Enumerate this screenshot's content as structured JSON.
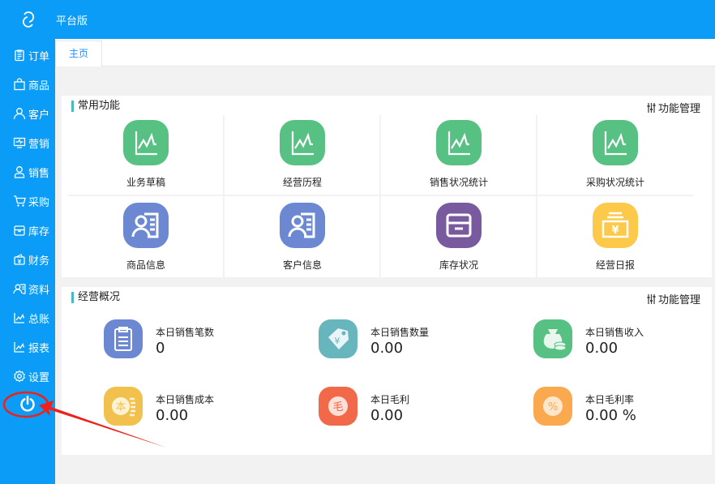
{
  "header": {
    "brand": "平台版",
    "logo_icon": "cloud-logo-icon"
  },
  "sidebar": {
    "items": [
      {
        "label": "订单",
        "icon": "clipboard-icon"
      },
      {
        "label": "商品",
        "icon": "bag-icon"
      },
      {
        "label": "客户",
        "icon": "user-icon"
      },
      {
        "label": "营销",
        "icon": "monitor-icon"
      },
      {
        "label": "销售",
        "icon": "person-icon"
      },
      {
        "label": "采购",
        "icon": "cart-icon"
      },
      {
        "label": "库存",
        "icon": "box-icon"
      },
      {
        "label": "财务",
        "icon": "wallet-icon"
      },
      {
        "label": "资料",
        "icon": "contact-icon"
      },
      {
        "label": "总账",
        "icon": "chart-icon"
      },
      {
        "label": "报表",
        "icon": "chart-icon"
      },
      {
        "label": "设置",
        "icon": "gear-icon"
      }
    ],
    "power_icon": "power-icon"
  },
  "tabs": [
    {
      "label": "主页"
    }
  ],
  "common": {
    "title": "常用功能",
    "manage": "功能管理",
    "items": [
      {
        "label": "业务草稿",
        "color": "#57c183"
      },
      {
        "label": "经营历程",
        "color": "#57c183"
      },
      {
        "label": "销售状况统计",
        "color": "#57c183"
      },
      {
        "label": "采购状况统计",
        "color": "#57c183"
      },
      {
        "label": "商品信息",
        "color": "#6d88d2"
      },
      {
        "label": "客户信息",
        "color": "#6d88d2"
      },
      {
        "label": "库存状况",
        "color": "#7a5a9e"
      },
      {
        "label": "经营日报",
        "color": "#fdc94a"
      }
    ]
  },
  "overview": {
    "title": "经营概况",
    "manage": "功能管理",
    "items": [
      {
        "label": "本日销售笔数",
        "value": "0",
        "color": "#6d88d2"
      },
      {
        "label": "本日销售数量",
        "value": "0.00",
        "color": "#68b6bd"
      },
      {
        "label": "本日销售收入",
        "value": "0.00",
        "color": "#57c183"
      },
      {
        "label": "本日销售成本",
        "value": "0.00",
        "color": "#f2c04c"
      },
      {
        "label": "本日毛利",
        "value": "0.00",
        "color": "#f2694a"
      },
      {
        "label": "本日毛利率",
        "value": "0.00 %",
        "color": "#fba94e"
      }
    ]
  },
  "annotation_color": "#f0201a"
}
